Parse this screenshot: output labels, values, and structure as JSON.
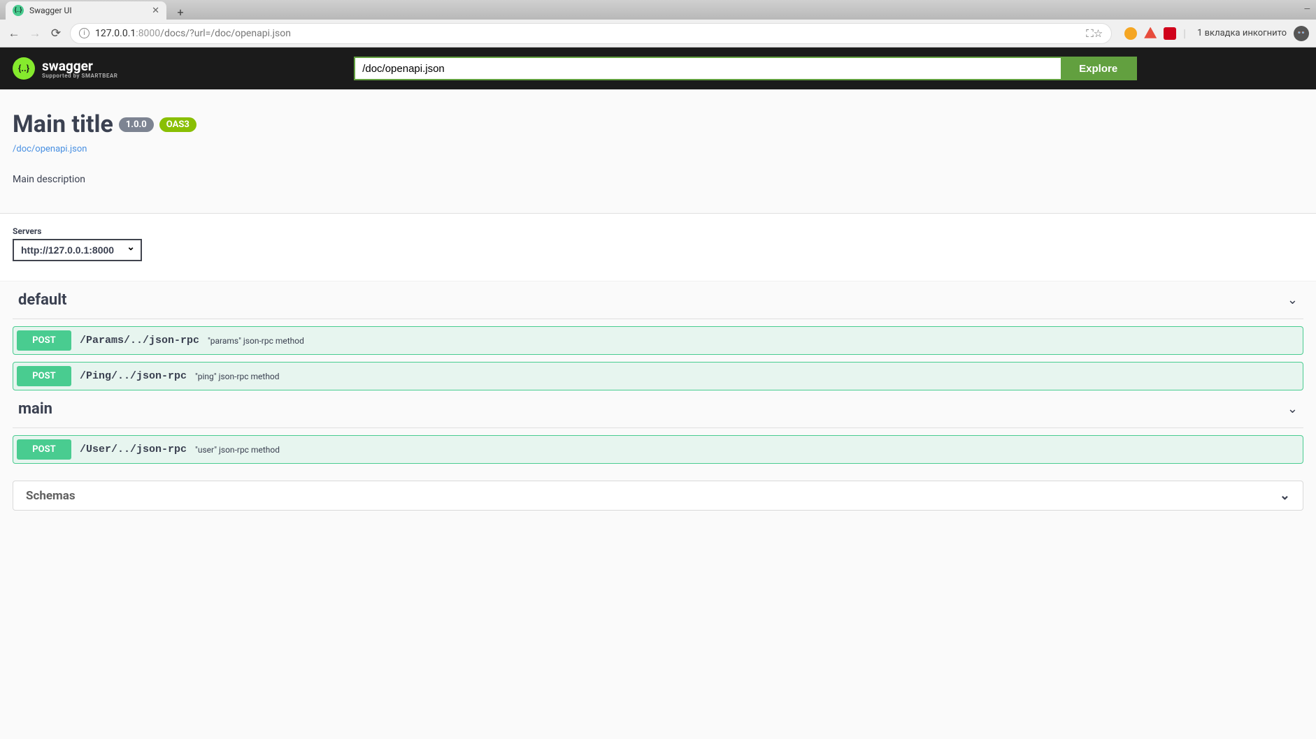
{
  "browser": {
    "tab_title": "Swagger UI",
    "url_host": "127.0.0.1",
    "url_port": ":8000",
    "url_path": "/docs/?url=/doc/openapi.json",
    "incognito_label": "1 вкладка инкогнито"
  },
  "topbar": {
    "logo_text": "swagger",
    "logo_sub": "Supported by SMARTBEAR",
    "input_value": "/doc/openapi.json",
    "explore_label": "Explore"
  },
  "info": {
    "title": "Main title",
    "version": "1.0.0",
    "oas": "OAS3",
    "spec_link": "/doc/openapi.json",
    "description": "Main description"
  },
  "servers": {
    "label": "Servers",
    "selected": "http://127.0.0.1:8000"
  },
  "tags": [
    {
      "name": "default",
      "operations": [
        {
          "method": "POST",
          "path": "/Params/../json-rpc",
          "description": "\"params\" json-rpc method"
        },
        {
          "method": "POST",
          "path": "/Ping/../json-rpc",
          "description": "\"ping\" json-rpc method"
        }
      ]
    },
    {
      "name": "main",
      "operations": [
        {
          "method": "POST",
          "path": "/User/../json-rpc",
          "description": "\"user\" json-rpc method"
        }
      ]
    }
  ],
  "schemas": {
    "title": "Schemas"
  }
}
